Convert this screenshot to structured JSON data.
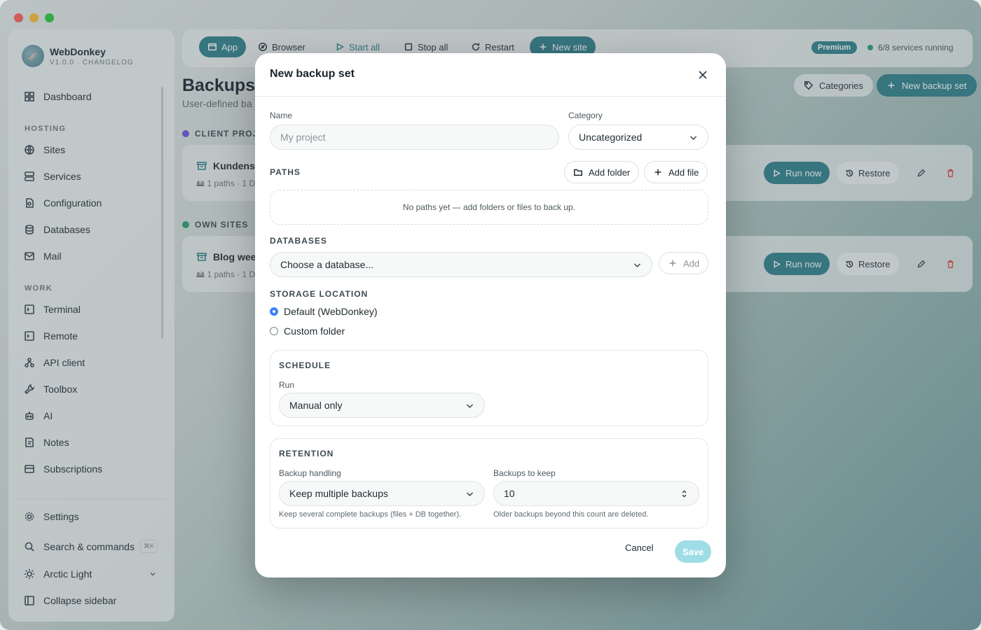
{
  "app": {
    "name": "WebDonkey",
    "version": "V1.0.0 · CHANGELOG"
  },
  "sidebar": {
    "dashboard": "Dashboard",
    "hosting_label": "HOSTING",
    "hosting": [
      "Sites",
      "Services",
      "Configuration",
      "Databases",
      "Mail"
    ],
    "work_label": "WORK",
    "work": [
      "Terminal",
      "Remote",
      "API client",
      "Toolbox",
      "AI",
      "Notes",
      "Subscriptions"
    ],
    "settings": "Settings",
    "search": "Search & commands",
    "search_kbd": "⌘K",
    "theme": "Arctic Light",
    "collapse": "Collapse sidebar"
  },
  "toolbar": {
    "app": "App",
    "browser": "Browser",
    "start_all": "Start all",
    "stop_all": "Stop all",
    "restart": "Restart",
    "new_site": "New site",
    "premium": "Premium",
    "status": "6/8 services running"
  },
  "page": {
    "title": "Backups",
    "subtitle": "User-defined ba",
    "categories_btn": "Categories",
    "new_btn": "New backup set"
  },
  "groups": [
    {
      "label": "CLIENT PROJ",
      "color": "#6d4ee0",
      "card_title": "Kundens",
      "card_meta": "1 paths · 1 D"
    },
    {
      "label": "OWN SITES",
      "color": "#2a9d6a",
      "card_title": "Blog wee",
      "card_meta": "1 paths · 1 D"
    }
  ],
  "card_actions": {
    "run": "Run now",
    "restore": "Restore"
  },
  "modal": {
    "title": "New backup set",
    "name_label": "Name",
    "name_placeholder": "My project",
    "category_label": "Category",
    "category_value": "Uncategorized",
    "paths_label": "PATHS",
    "add_folder": "Add folder",
    "add_file": "Add file",
    "paths_empty": "No paths yet — add folders or files to back up.",
    "databases_label": "DATABASES",
    "db_placeholder": "Choose a database...",
    "db_add": "Add",
    "storage_label": "STORAGE LOCATION",
    "storage_default": "Default (WebDonkey)",
    "storage_custom": "Custom folder",
    "schedule_label": "SCHEDULE",
    "run_label": "Run",
    "run_value": "Manual only",
    "retention_label": "RETENTION",
    "handling_label": "Backup handling",
    "handling_value": "Keep multiple backups",
    "handling_hint": "Keep several complete backups (files + DB together).",
    "keep_label": "Backups to keep",
    "keep_value": "10",
    "keep_hint": "Older backups beyond this count are deleted.",
    "cancel": "Cancel",
    "save": "Save"
  }
}
